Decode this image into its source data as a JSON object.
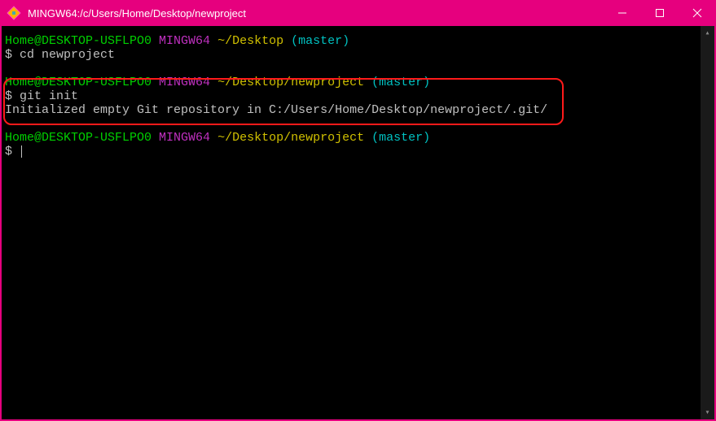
{
  "window": {
    "title": "MINGW64:/c/Users/Home/Desktop/newproject"
  },
  "colors": {
    "accent": "#e6007e"
  },
  "blocks": [
    {
      "prompt": {
        "user": "Home@DESKTOP-USFLPO0",
        "env": "MINGW64",
        "path": "~/Desktop",
        "branch": "(master)"
      },
      "command": "cd newproject",
      "output": []
    },
    {
      "prompt": {
        "user": "Home@DESKTOP-USFLPO0",
        "env": "MINGW64",
        "path": "~/Desktop/newproject",
        "branch": "(master)"
      },
      "command": "git init",
      "output": [
        "Initialized empty Git repository in C:/Users/Home/Desktop/newproject/.git/"
      ]
    },
    {
      "prompt": {
        "user": "Home@DESKTOP-USFLPO0",
        "env": "MINGW64",
        "path": "~/Desktop/newproject",
        "branch": "(master)"
      },
      "command": "",
      "output": []
    }
  ],
  "dollar": "$"
}
